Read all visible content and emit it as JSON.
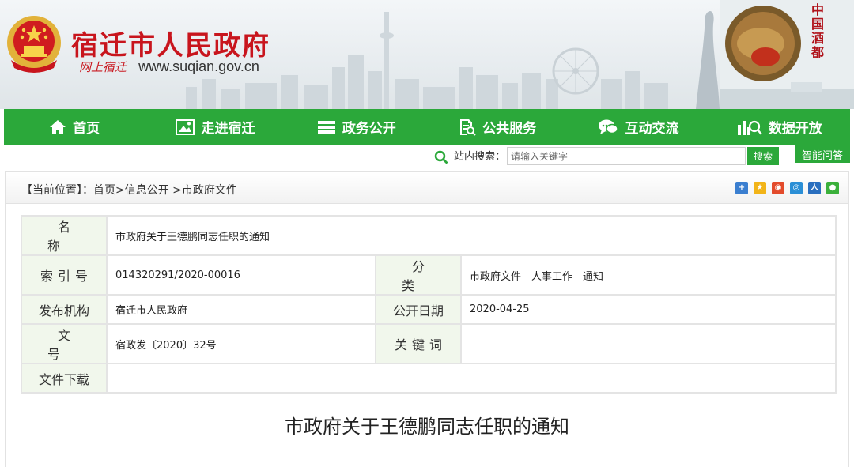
{
  "header": {
    "site_title": "宿迁市人民政府",
    "site_brand": "网上宿迁",
    "site_url": "www.suqian.gov.cn",
    "side_text": "中国酒都",
    "colors": {
      "title_red": "#c8151d",
      "nav_green": "#2ba83a"
    }
  },
  "nav": {
    "items": [
      {
        "label": "首页",
        "icon": "home-icon"
      },
      {
        "label": "走进宿迁",
        "icon": "picture-icon"
      },
      {
        "label": "政务公开",
        "icon": "stack-icon"
      },
      {
        "label": "公共服务",
        "icon": "document-search-icon"
      },
      {
        "label": "互动交流",
        "icon": "chat-icon"
      },
      {
        "label": "数据开放",
        "icon": "chart-search-icon"
      }
    ]
  },
  "search": {
    "label": "站内搜索：",
    "placeholder": "请输入关键字",
    "button": "搜索",
    "ai_button": "智能问答"
  },
  "breadcrumb": {
    "text": "【当前位置】：首页>信息公开 >市政府文件"
  },
  "share": {
    "icons": [
      "plus-share-icon",
      "qzone-icon",
      "weibo-icon",
      "tencent-weibo-icon",
      "renren-icon",
      "wechat-icon"
    ]
  },
  "info": {
    "name_label": "名称",
    "name_value": "市政府关于王德鹏同志任职的通知",
    "index_label": "索引号",
    "index_value": "014320291/2020-00016",
    "category_label": "分类",
    "category_value": "市政府文件　人事工作　通知",
    "publisher_label": "发布机构",
    "publisher_value": "宿迁市人民政府",
    "date_label": "公开日期",
    "date_value": "2020-04-25",
    "docno_label": "文号",
    "docno_value": "宿政发〔2020〕32号",
    "keyword_label": "关键词",
    "keyword_value": "",
    "download_label": "文件下载",
    "download_value": ""
  },
  "document": {
    "title": "市政府关于王德鹏同志任职的通知"
  }
}
